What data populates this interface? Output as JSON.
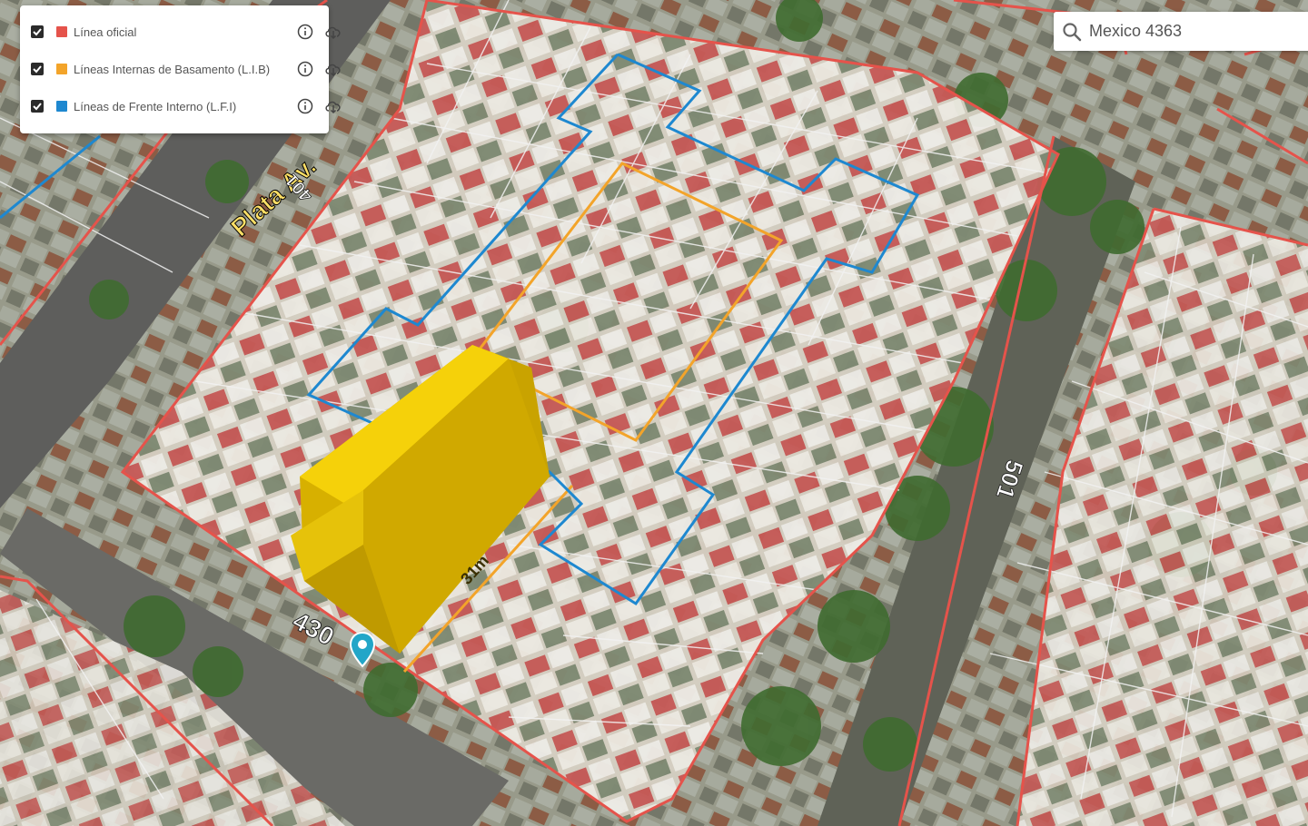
{
  "layers": [
    {
      "label": "Línea oficial",
      "color": "#e5534b",
      "checked": true,
      "info_icon": "info-icon",
      "download_icon": "cloud-download-icon"
    },
    {
      "label": "Líneas Internas de Basamento (L.I.B)",
      "color": "#f3a42a",
      "checked": true,
      "info_icon": "info-icon",
      "download_icon": "cloud-download-icon"
    },
    {
      "label": "Líneas de Frente Interno (L.F.I)",
      "color": "#1e88d0",
      "checked": true,
      "info_icon": "info-icon",
      "download_icon": "cloud-download-icon"
    }
  ],
  "search": {
    "value": "Mexico 4363",
    "icon": "search-icon"
  },
  "map_labels": {
    "street_name": "Plata Av.",
    "block_number_401": "401",
    "block_number_501": "501",
    "frontage_measure": "31m",
    "address_number": "430"
  },
  "colors": {
    "building": "#f0c808",
    "parcel_lines": "#f2f2f2",
    "block_outline": "#e5534b"
  }
}
